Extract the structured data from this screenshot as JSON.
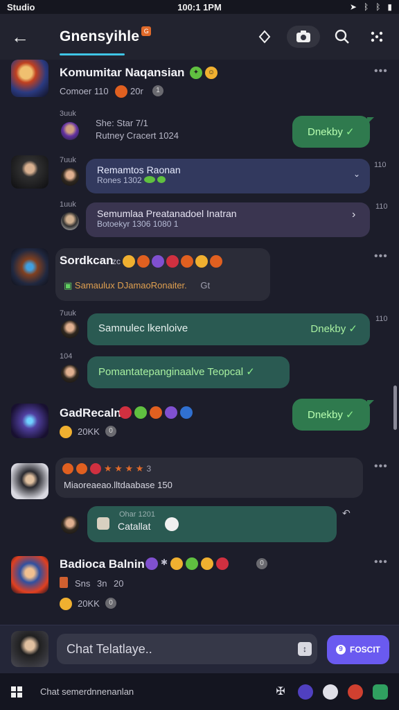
{
  "status_bar": {
    "left": "Studio",
    "time": "100:1 1PM",
    "right_icons": [
      "location-icon",
      "bluetooth-icon",
      "bluetooth-alt-icon",
      "battery-icon"
    ]
  },
  "header": {
    "title": "Gnensyihle",
    "badge": "G",
    "accent": "#3fc6e6",
    "actions": [
      "location-pin-icon",
      "camera-icon",
      "search-icon",
      "more-options-icon"
    ]
  },
  "chat": {
    "groups": [
      {
        "name": "Komumitar Naqansian",
        "sub": "Comoer 110",
        "count": "20r",
        "badge": "1",
        "reply": {
          "meta": "3uuk",
          "line1": "She: Star 7/1",
          "line2": "Rutney Cracert 1024",
          "status": "Dnekby"
        }
      },
      {
        "meta": "7uuk",
        "line1": "Remamtos Raonan",
        "line2": "Rones 1302",
        "time": "110"
      },
      {
        "meta": "1uuk",
        "line1": "Semumlaa Preatanadoel Inatran",
        "line2": "Botoekyr 1306 1080 1",
        "time": "110"
      },
      {
        "name": "Sordkcan",
        "emoji_note": "zc",
        "card_text": "Samaulux DJamaoRonaiter.",
        "card_meta": "Gt",
        "replies": [
          {
            "meta": "7uuk",
            "text": "Samnulec lkenloive",
            "status": "Dnekby",
            "time": "110"
          },
          {
            "meta": "104",
            "text": "Pomantatepanginaalve Teopcal",
            "status": ""
          }
        ]
      },
      {
        "name": "GadRecaln",
        "count": "20KK",
        "badge": "0",
        "status": "Dnekby"
      },
      {
        "stars": "★ ★ ★ ★",
        "stars_note": "3",
        "card_text": "Miaoreaeao.lltdaabase 150",
        "reply": {
          "meta": "Ohar 1201",
          "text": "Catallat"
        }
      },
      {
        "name": "Badioca Balnin",
        "sub": "Sns",
        "sub_num": "3n",
        "sub_count": "20",
        "badge": "0",
        "count": "20KK"
      }
    ]
  },
  "composer": {
    "placeholder": "Chat Telatlaye..",
    "send_label": "FOSCIT"
  },
  "bottom_bar": {
    "status": "Chat semerdnnenanlan"
  },
  "colors": {
    "green_bubble": "#2f7a4e",
    "teal_bubble": "#2a5a52",
    "blue_bubble": "#32395e",
    "send_button": "#6a5af0"
  }
}
